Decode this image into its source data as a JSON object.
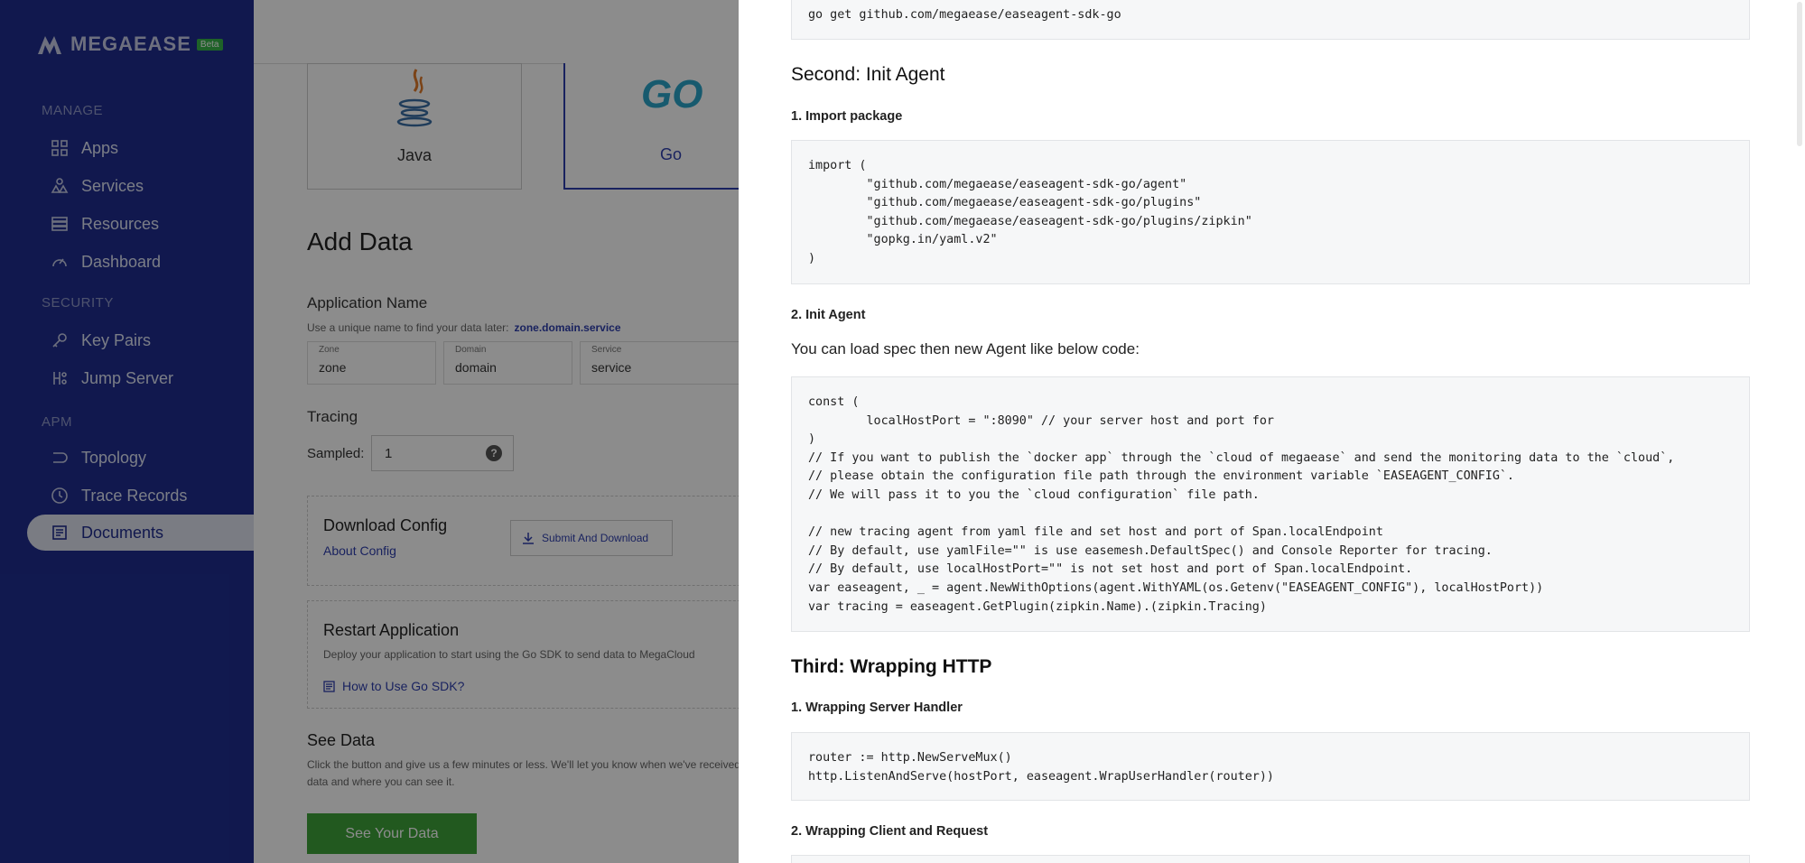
{
  "sidebar": {
    "logo_text": "MEGAEASE",
    "beta_badge": "Beta",
    "sections": {
      "manage": "MANAGE",
      "security": "SECURITY",
      "apm": "APM"
    },
    "items": {
      "apps": "Apps",
      "services": "Services",
      "resources": "Resources",
      "dashboard": "Dashboard",
      "key_pairs": "Key Pairs",
      "jump_server": "Jump Server",
      "topology": "Topology",
      "trace_records": "Trace Records",
      "documents": "Documents"
    },
    "active_item": "Documents"
  },
  "main": {
    "languages": {
      "java": "Java",
      "go": "Go",
      "go_logo": "GO"
    },
    "add_data_title": "Add Data",
    "application_name": {
      "title": "Application Name",
      "hint": "Use a unique name to find your data later:",
      "hint_link": "zone.domain.service",
      "zone_label": "Zone",
      "zone_value": "zone",
      "domain_label": "Domain",
      "domain_value": "domain",
      "service_label": "Service",
      "service_value": "service"
    },
    "tracing": {
      "title": "Tracing",
      "sampled_label": "Sampled:",
      "sampled_value": "1",
      "help_icon": "?"
    },
    "download_config": {
      "title": "Download Config",
      "link": "About Config",
      "submit_label": "Submit And Download"
    },
    "restart": {
      "title": "Restart Application",
      "desc": "Deploy your application to start using the Go SDK to send data to MegaCloud",
      "link": "How to Use Go SDK?"
    },
    "see_data": {
      "title": "See Data",
      "desc": "Click the button and give us a few minutes or less. We'll let you know when we've received your data and where you can see it.",
      "button": "See Your Data"
    }
  },
  "drawer": {
    "top_code": "go get github.com/megaease/easeagent-sdk-go",
    "second_title": "Second: Init Agent",
    "import_title": "1. Import package",
    "import_code": "import (\n        \"github.com/megaease/easeagent-sdk-go/agent\"\n        \"github.com/megaease/easeagent-sdk-go/plugins\"\n        \"github.com/megaease/easeagent-sdk-go/plugins/zipkin\"\n        \"gopkg.in/yaml.v2\"\n)",
    "init_title": "2. Init Agent",
    "init_desc": "You can load spec then new Agent like below code:",
    "init_code": "const (\n        localHostPort = \":8090\" // your server host and port for\n)\n// If you want to publish the `docker app` through the `cloud of megaease` and send the monitoring data to the `cloud`,\n// please obtain the configuration file path through the environment variable `EASEAGENT_CONFIG`.\n// We will pass it to you the `cloud configuration` file path.\n\n// new tracing agent from yaml file and set host and port of Span.localEndpoint\n// By default, use yamlFile=\"\" is use easemesh.DefaultSpec() and Console Reporter for tracing.\n// By default, use localHostPort=\"\" is not set host and port of Span.localEndpoint.\nvar easeagent, _ = agent.NewWithOptions(agent.WithYAML(os.Getenv(\"EASEAGENT_CONFIG\"), localHostPort))\nvar tracing = easeagent.GetPlugin(zipkin.Name).(zipkin.Tracing)",
    "third_title": "Third: Wrapping HTTP",
    "server_title": "1. Wrapping Server Handler",
    "server_code": "router := http.NewServeMux()\nhttp.ListenAndServe(hostPort, easeagent.WrapUserHandler(router))",
    "client_title": "2. Wrapping Client and Request"
  },
  "colors": {
    "sidebar_bg": "#1f2d8f",
    "accent": "#2f3fae",
    "success": "#3fa33a"
  },
  "icons": [
    "grid-icon",
    "services-icon",
    "list-icon",
    "gauge-icon",
    "key-icon",
    "jump-server-icon",
    "topology-icon",
    "clock-icon",
    "document-icon",
    "download-icon",
    "java-icon",
    "help-icon"
  ]
}
